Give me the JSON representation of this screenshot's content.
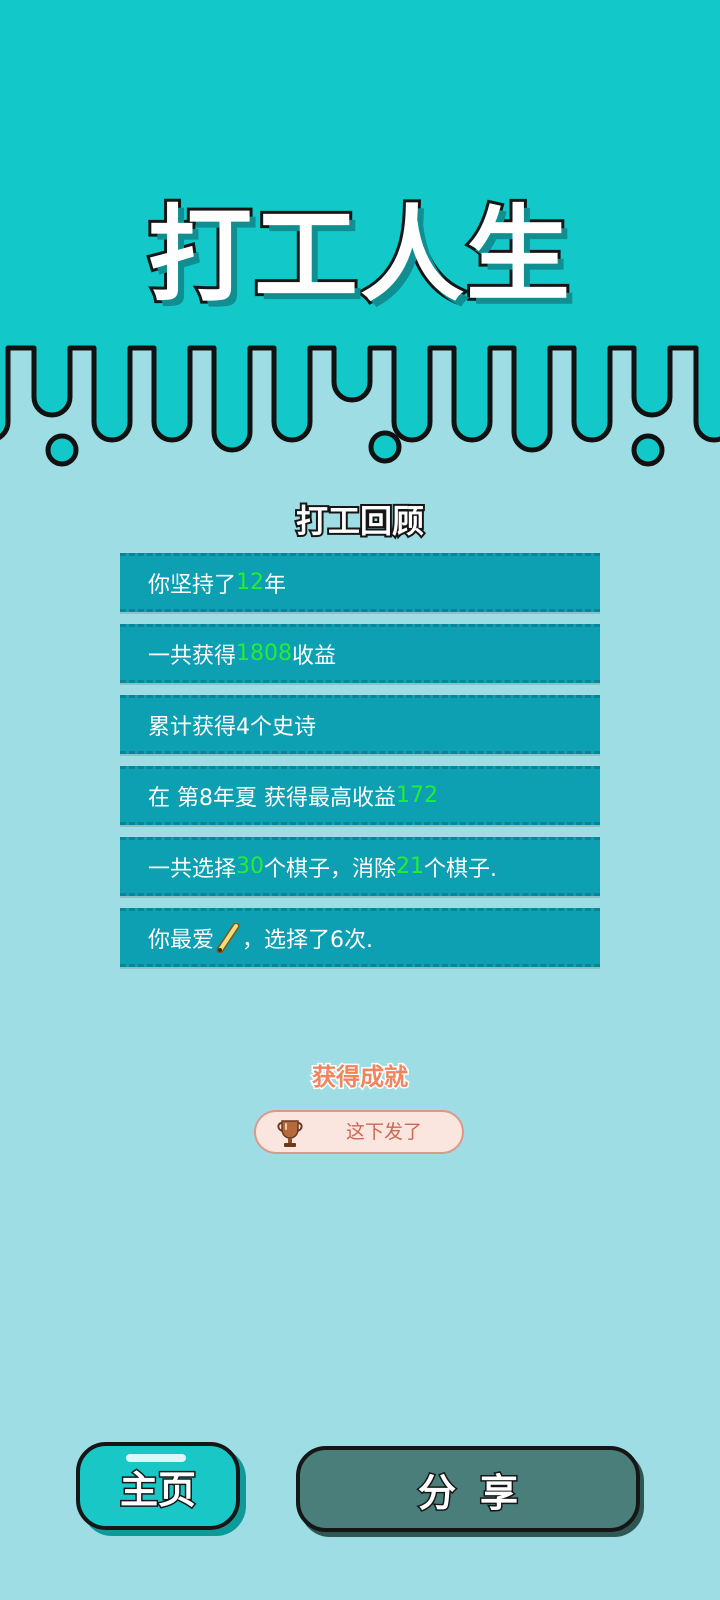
{
  "title": "打工人生",
  "review": {
    "heading": "打工回顾",
    "rows": [
      {
        "pre": "你坚持了",
        "hl": "12",
        "post": "年"
      },
      {
        "pre": "一共获得",
        "hl": "1808",
        "post": "收益"
      },
      {
        "pre": "累计获得4个史诗",
        "hl": "",
        "post": ""
      },
      {
        "pre": "在 第8年夏 获得最高收益",
        "hl": "172",
        "post": ""
      },
      {
        "pre": "一共选择",
        "hl": "30",
        "mid": "个棋子，消除",
        "hl2": "21",
        "post": "个棋子."
      },
      {
        "pre": "你最爱",
        "icon": "pencil-icon",
        "post": "，选择了6次."
      }
    ]
  },
  "achievement": {
    "heading": "获得成就",
    "icon": "trophy-icon",
    "name": "这下发了"
  },
  "buttons": {
    "home": "主页",
    "share": "分享"
  },
  "colors": {
    "top_bg": "#13c8c8",
    "body_bg": "#9edde4",
    "row_bg": "#0d9fb2",
    "highlight": "#22ee33",
    "achievement_text": "#f0845f",
    "share_btn": "#4a7e7b"
  }
}
